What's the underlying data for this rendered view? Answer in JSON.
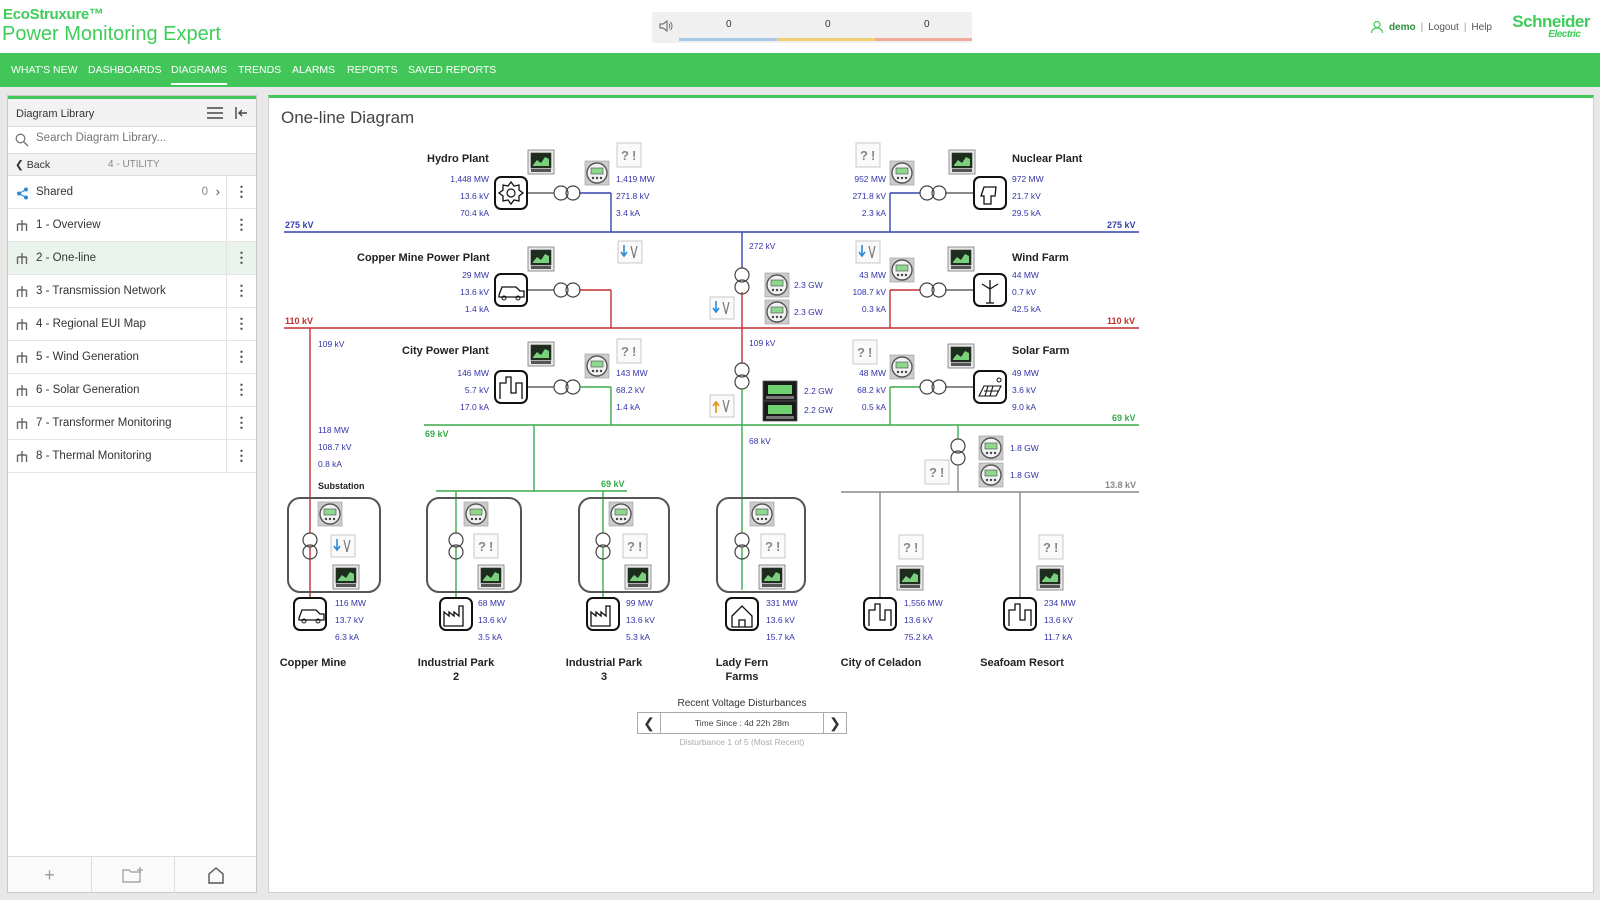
{
  "app": {
    "brand_top": "EcoStruxure™",
    "brand_product": "Power Monitoring Expert",
    "vendor": "Schneider",
    "vendor_sub": "Electric"
  },
  "alarms": {
    "counts": [
      "0",
      "0",
      "0"
    ],
    "colors": [
      "#a8c8e8",
      "#f0d070",
      "#f0a898"
    ]
  },
  "user": {
    "name": "demo",
    "logout": "Logout",
    "help": "Help"
  },
  "nav": {
    "items": [
      "WHAT'S NEW",
      "DASHBOARDS",
      "DIAGRAMS",
      "TRENDS",
      "ALARMS",
      "REPORTS",
      "SAVED REPORTS"
    ],
    "active": "DIAGRAMS"
  },
  "library": {
    "title": "Diagram Library",
    "search_placeholder": "Search Diagram Library...",
    "back_label": "Back",
    "level": "4 - UTILITY",
    "shared_label": "Shared",
    "shared_count": "0",
    "items": [
      "1 - Overview",
      "2 - One-line",
      "3 - Transmission Network",
      "4 - Regional EUI Map",
      "5 - Wind Generation",
      "6 - Solar Generation",
      "7 - Transformer Monitoring",
      "8 - Thermal Monitoring"
    ],
    "active_index": 1
  },
  "diagram": {
    "title": "One-line Diagram",
    "buses": {
      "bus275_left": "275 kV",
      "bus275_right": "275 kV",
      "bus110_left": "110 kV",
      "bus110_right": "110 kV",
      "bus69_left": "69 kV",
      "bus69_right": "69 kV",
      "bus69_sub": "69 kV",
      "bus138": "13.8 kV"
    },
    "plants": {
      "hydro": {
        "name": "Hydro Plant",
        "gen": [
          "1,448 MW",
          "13.6 kV",
          "70.4 kA"
        ],
        "meter": [
          "1,419 MW",
          "271.8 kV",
          "3.4 kA"
        ]
      },
      "nuclear": {
        "name": "Nuclear Plant",
        "gen": [
          "972 MW",
          "21.7 kV",
          "29.5 kA"
        ],
        "meter": [
          "952 MW",
          "271.8 kV",
          "2.3 kA"
        ]
      },
      "copper_plant": {
        "name": "Copper Mine Power Plant",
        "gen": [
          "29 MW",
          "13.6 kV",
          "1.4 kA"
        ]
      },
      "wind": {
        "name": "Wind Farm",
        "gen": [
          "44 MW",
          "0.7 kV",
          "42.5 kA"
        ],
        "meter": [
          "43 MW",
          "108.7 kV",
          "0.3 kA"
        ]
      },
      "city": {
        "name": "City Power Plant",
        "gen": [
          "146 MW",
          "5.7 kV",
          "17.0 kA"
        ],
        "meter": [
          "143 MW",
          "68.2 kV",
          "1.4 kA"
        ]
      },
      "solar": {
        "name": "Solar Farm",
        "gen": [
          "49 MW",
          "3.6 kV",
          "9.0 kA"
        ],
        "meter": [
          "48 MW",
          "68.2 kV",
          "0.5 kA"
        ]
      }
    },
    "ties": {
      "t272": "272 kV",
      "gw1": "2.3 GW",
      "gw2": "2.3 GW",
      "t109": "109 kV",
      "gw3": "2.2 GW",
      "gw4": "2.2 GW",
      "t68": "68 kV",
      "t109b": "109 kV",
      "gw5": "1.8 GW",
      "gw6": "1.8 GW"
    },
    "substation": {
      "name": "Substation",
      "readings": [
        "118 MW",
        "108.7 kV",
        "0.8 kA"
      ]
    },
    "loads": [
      {
        "name1": "Copper Mine",
        "name2": "",
        "vals": [
          "116 MW",
          "13.7 kV",
          "6.3 kA"
        ]
      },
      {
        "name1": "Industrial Park",
        "name2": "2",
        "vals": [
          "68 MW",
          "13.6 kV",
          "3.5 kA"
        ]
      },
      {
        "name1": "Industrial Park",
        "name2": "3",
        "vals": [
          "99 MW",
          "13.6 kV",
          "5.3 kA"
        ]
      },
      {
        "name1": "Lady Fern",
        "name2": "Farms",
        "vals": [
          "331 MW",
          "13.6 kV",
          "15.7 kA"
        ]
      },
      {
        "name1": "City of Celadon",
        "name2": "",
        "vals": [
          "1,556 MW",
          "13.6 kV",
          "75.2 kA"
        ]
      },
      {
        "name1": "Seafoam Resort",
        "name2": "",
        "vals": [
          "234 MW",
          "13.6 kV",
          "11.7 kA"
        ]
      }
    ],
    "colors": {
      "bus275": "#3344aa",
      "bus110": "#c03030",
      "bus69": "#3aaa4a",
      "bus138": "#888888"
    }
  },
  "disturbance": {
    "title": "Recent Voltage Disturbances",
    "time_since": "Time Since : 4d 22h 28m",
    "sub": "Disturbance 1 of 5 (Most Recent)"
  }
}
